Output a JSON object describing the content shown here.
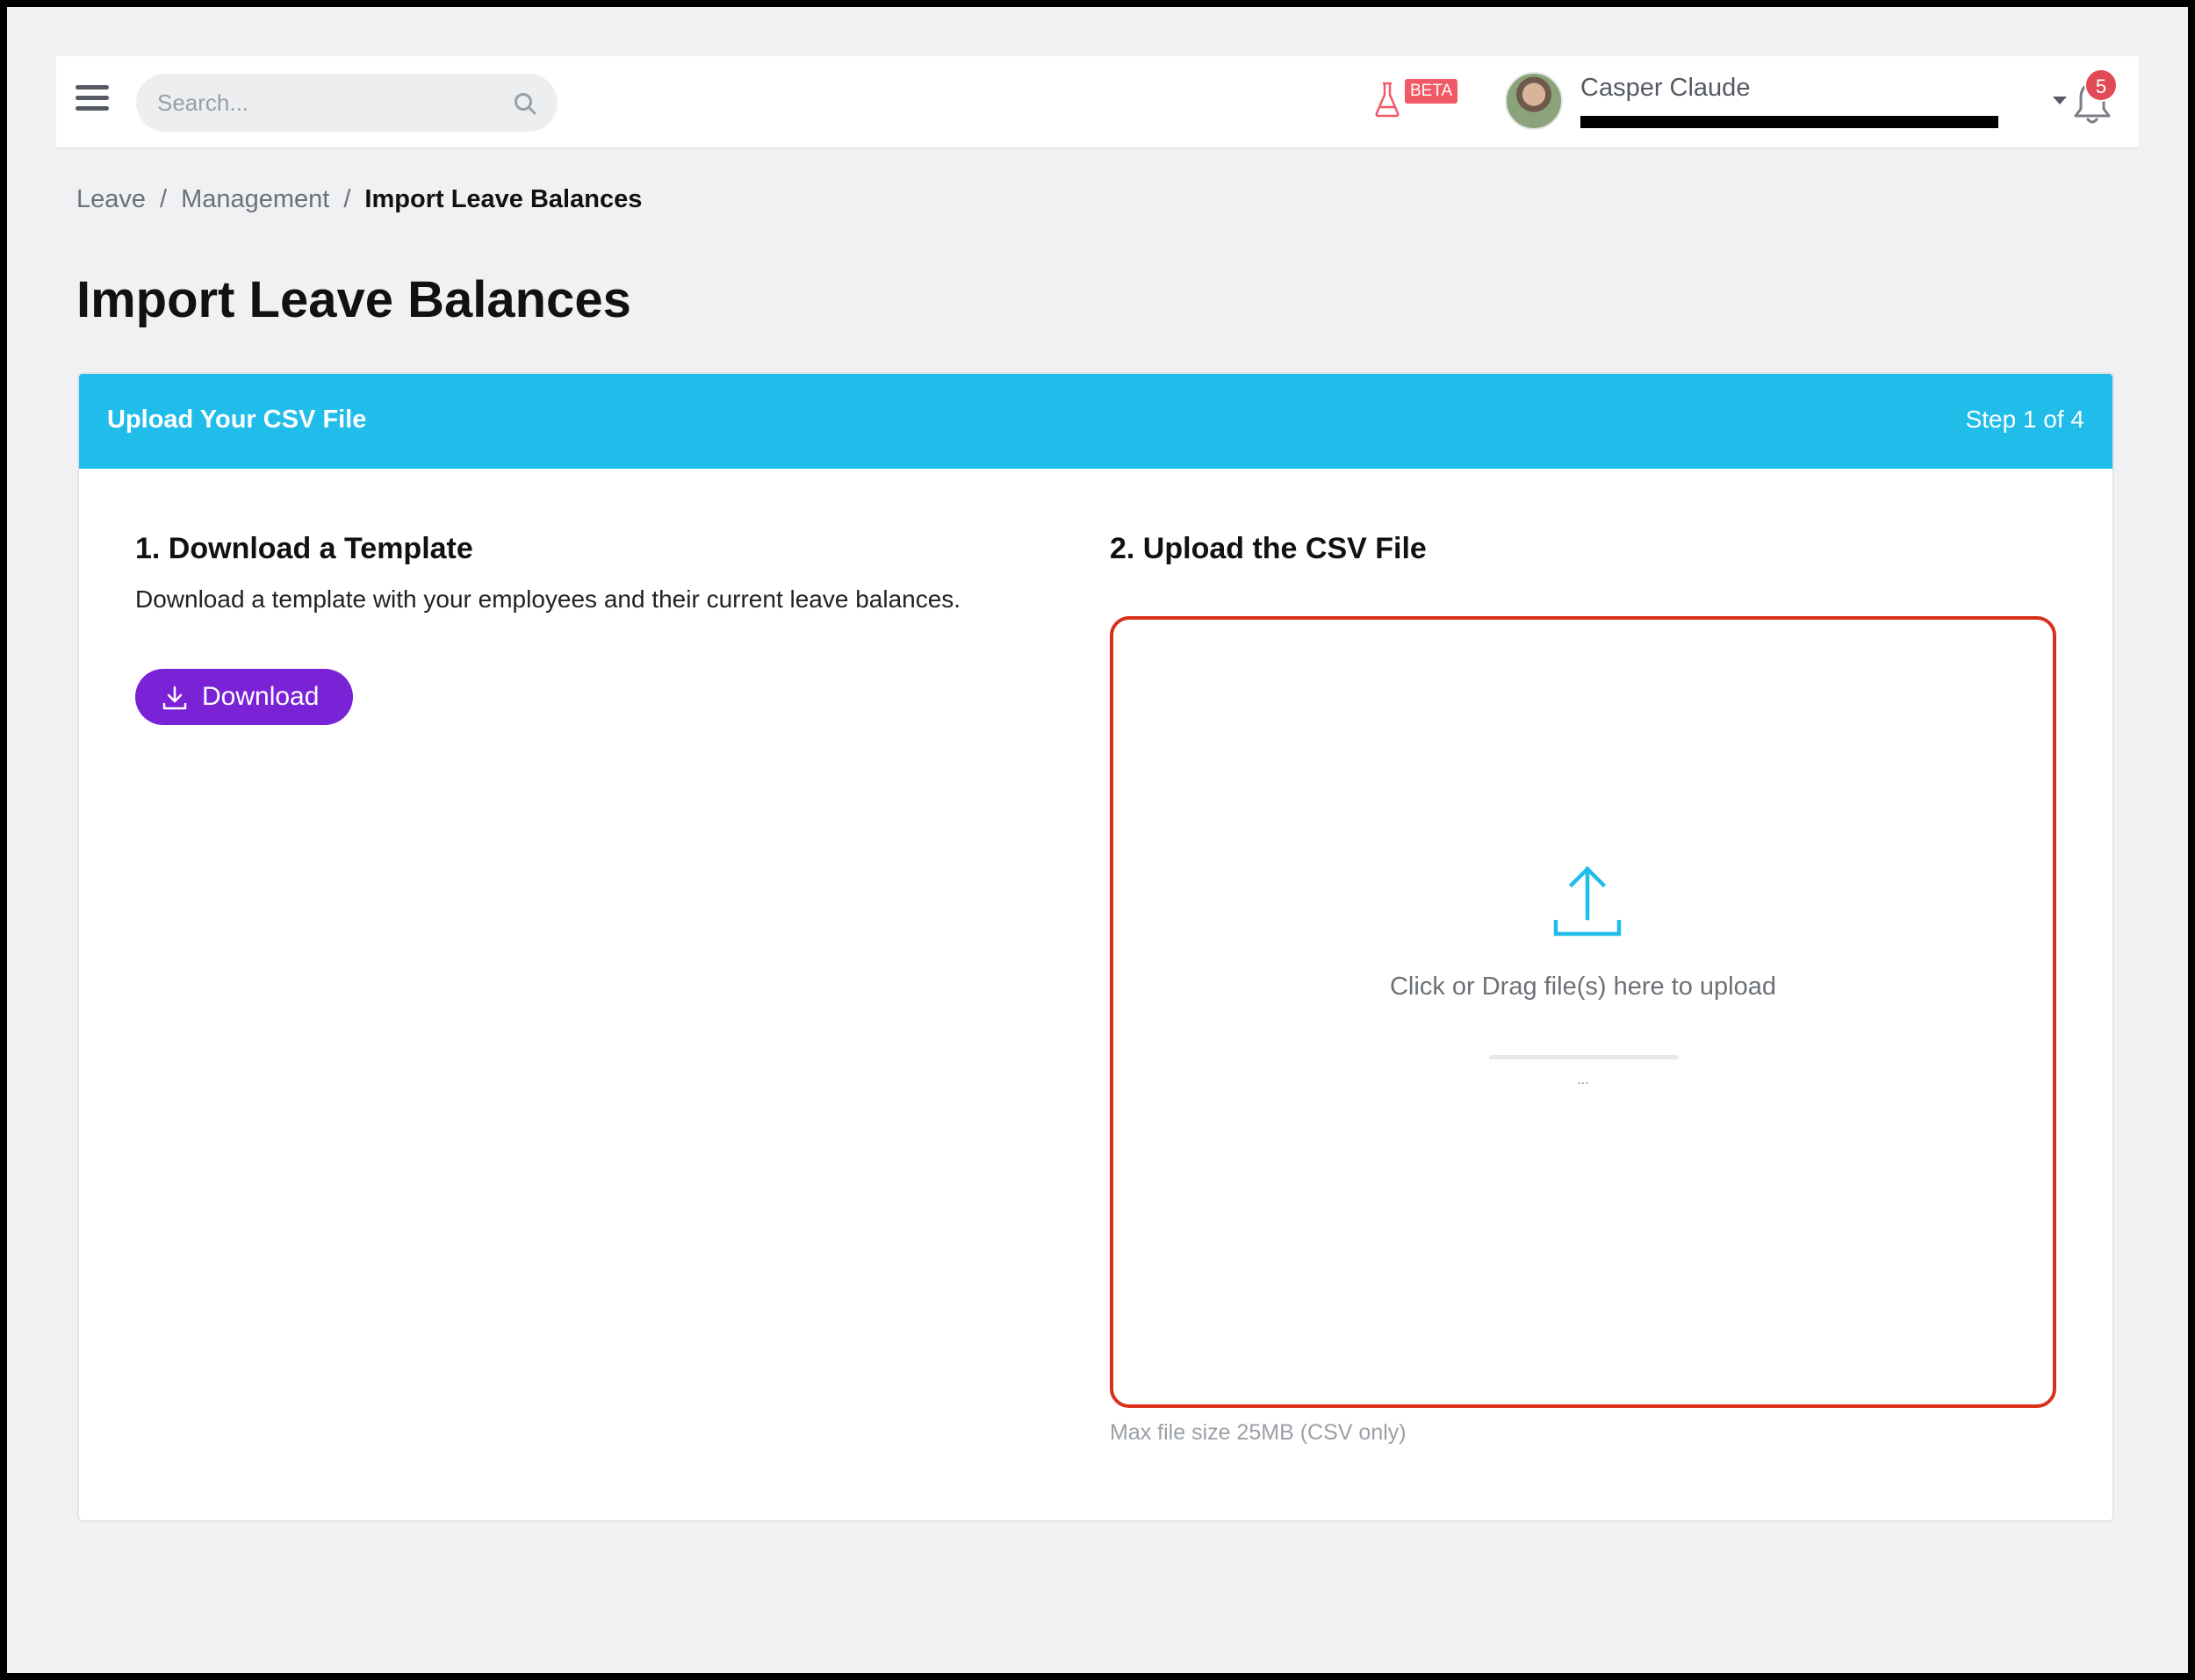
{
  "topbar": {
    "search_placeholder": "Search...",
    "beta_label": "BETA",
    "user_name": "Casper Claude",
    "notification_count": "5"
  },
  "breadcrumb": {
    "items": [
      "Leave",
      "Management"
    ],
    "separator": "/",
    "current": "Import Leave Balances"
  },
  "page": {
    "title": "Import Leave Balances"
  },
  "card": {
    "header_title": "Upload Your CSV File",
    "step": "Step 1 of 4",
    "download_section": {
      "title": "1. Download a Template",
      "description": "Download a template with your employees and their current leave balances.",
      "button_label": "Download"
    },
    "upload_section": {
      "title": "2. Upload the CSV File",
      "dropzone_text": "Click or Drag file(s) here to upload",
      "dots": "...",
      "hint": "Max file size 25MB (CSV only)"
    }
  },
  "colors": {
    "header": "#20bdeb",
    "primary_button": "#7a22d6",
    "dropzone_border": "#d9301b",
    "badge": "#e04b56"
  }
}
